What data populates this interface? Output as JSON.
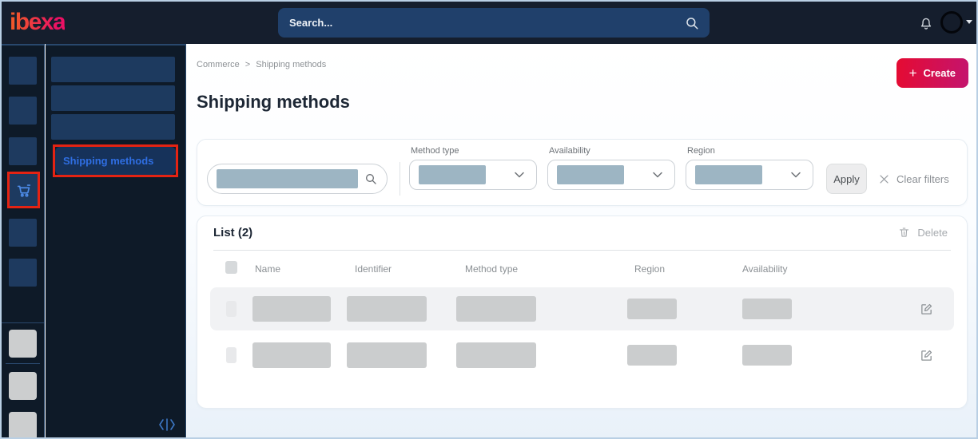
{
  "topbar": {
    "logo_text": "ibexa",
    "search_placeholder": "Search..."
  },
  "submenu": {
    "active_label": "Shipping methods"
  },
  "breadcrumb": {
    "items": [
      "Commerce",
      "Shipping methods"
    ],
    "separator": ">"
  },
  "header": {
    "title": "Shipping methods",
    "create_label": "Create",
    "create_plus": "+"
  },
  "filters": {
    "selects": [
      {
        "label": "Method type"
      },
      {
        "label": "Availability"
      },
      {
        "label": "Region"
      }
    ],
    "apply_label": "Apply",
    "clear_label": "Clear filters"
  },
  "list": {
    "title": "List (2)",
    "delete_label": "Delete",
    "columns": [
      "Name",
      "Identifier",
      "Method type",
      "Region",
      "Availability"
    ],
    "row_count": 2
  },
  "colors": {
    "brand_gradient_start": "#f0562b",
    "brand_gradient_end": "#ec1164",
    "create_gradient_start": "#e50b32",
    "create_gradient_end": "#c4146e",
    "annotation_red": "#e42313",
    "active_link_blue": "#2f6ee2",
    "topbar_bg": "#151e2d",
    "sidebar_bg": "#0e1a28",
    "sidebar_tile": "#1e3a5f",
    "redaction_blue": "#9db5c3",
    "redaction_gray": "#cbcdce",
    "row_alt_bg": "#f1f2f4"
  }
}
